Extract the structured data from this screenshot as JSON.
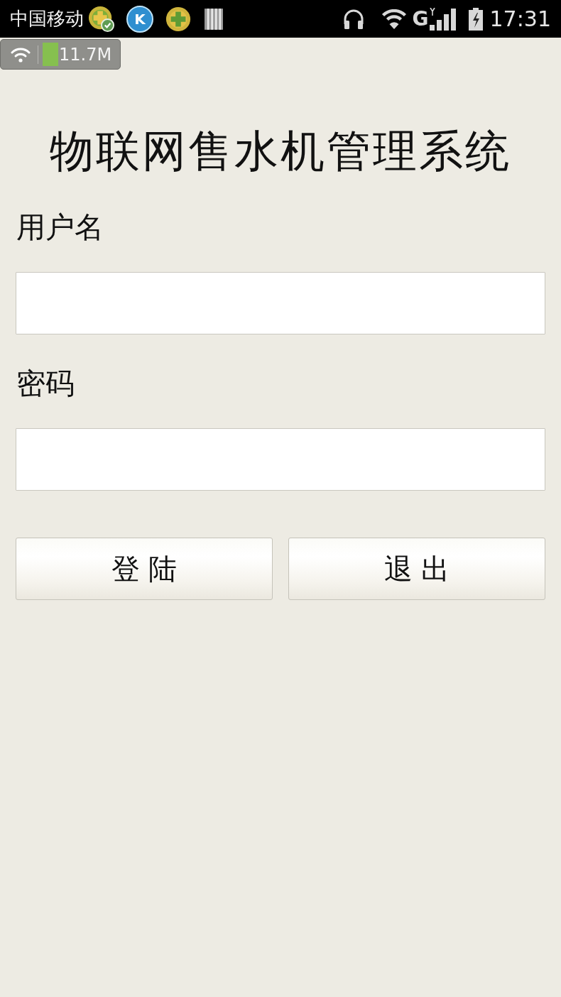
{
  "status_bar": {
    "carrier": "中国移动",
    "app_icon_letter": "K",
    "network_type": "G",
    "time": "17:31"
  },
  "network_widget": {
    "speed": "11.7M"
  },
  "title": "物联网售水机管理系统",
  "form": {
    "fields": [
      {
        "label": "用户名"
      },
      {
        "label": "密码"
      }
    ]
  },
  "buttons": [
    {
      "label": "登 陆"
    },
    {
      "label": "退 出"
    }
  ]
}
